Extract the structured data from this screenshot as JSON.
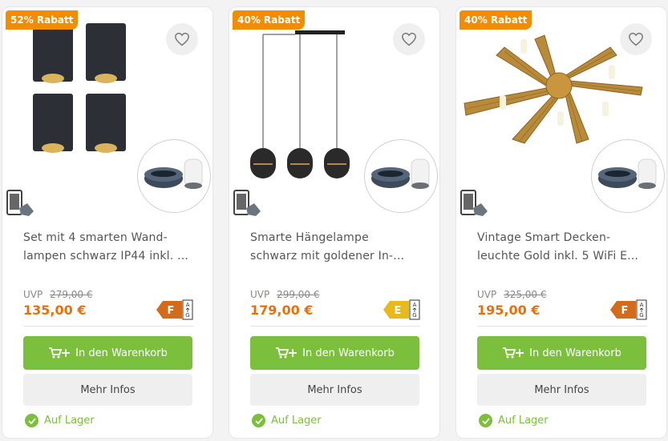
{
  "products": [
    {
      "discount": "52% Rabatt",
      "title": "Set mit 4 smarten Wand-lampen schwarz IP44 inkl. ...",
      "title_line1": "Set mit 4 smarten Wand-",
      "title_line2": "lampen schwarz IP44 inkl. ...",
      "uvp_label": "UVP",
      "uvp_price": "279,00 €",
      "price": "135,00 €",
      "energy_class": "F",
      "energy_top": "A",
      "energy_bottom": "G",
      "energy_color": "#d46b1a",
      "cart_label": "In den Warenkorb",
      "info_label": "Mehr Infos",
      "stock": "Auf Lager",
      "image": "wall-lamps-icon"
    },
    {
      "discount": "40% Rabatt",
      "title": "Smarte Hängelampe schwarz mit goldener In-...",
      "title_line1": "Smarte Hängelampe",
      "title_line2": "schwarz mit goldener In-...",
      "uvp_label": "UVP",
      "uvp_price": "299,00 €",
      "price": "179,00 €",
      "energy_class": "E",
      "energy_top": "A",
      "energy_bottom": "G",
      "energy_color": "#e8b91b",
      "cart_label": "In den Warenkorb",
      "info_label": "Mehr Infos",
      "stock": "Auf Lager",
      "image": "pendant-lamp-icon"
    },
    {
      "discount": "40% Rabatt",
      "title": "Vintage Smart Decken-leuchte Gold inkl. 5 WiFi E...",
      "title_line1": "Vintage Smart Decken-",
      "title_line2": "leuchte Gold inkl. 5 WiFi E...",
      "uvp_label": "UVP",
      "uvp_price": "325,00 €",
      "price": "195,00 €",
      "energy_class": "F",
      "energy_top": "A",
      "energy_bottom": "G",
      "energy_color": "#d46b1a",
      "cart_label": "In den Warenkorb",
      "info_label": "Mehr Infos",
      "stock": "Auf Lager",
      "image": "ceiling-leaf-lamp-icon"
    }
  ],
  "colors": {
    "discount": "#f28c00",
    "price": "#e8700b",
    "cart_button": "#7bbf3c",
    "stock": "#7bbf3c"
  }
}
